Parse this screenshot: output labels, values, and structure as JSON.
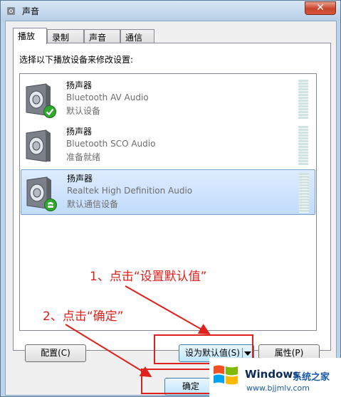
{
  "window": {
    "title": "声音",
    "close_glyph": "✕"
  },
  "tabs": [
    {
      "label": "播放",
      "active": true
    },
    {
      "label": "录制",
      "active": false
    },
    {
      "label": "声音",
      "active": false
    },
    {
      "label": "通信",
      "active": false
    }
  ],
  "instruction": "选择以下播放设备来修改设置:",
  "devices": [
    {
      "name": "扬声器",
      "description": "Bluetooth AV Audio",
      "status": "默认设备",
      "badge": "green-check",
      "selected": false
    },
    {
      "name": "扬声器",
      "description": "Bluetooth SCO Audio",
      "status": "准备就绪",
      "badge": "none",
      "selected": false
    },
    {
      "name": "扬声器",
      "description": "Realtek High Definition Audio",
      "status": "默认通信设备",
      "badge": "green-phone",
      "selected": true
    }
  ],
  "buttons": {
    "configure": "配置(C)",
    "set_default": "设为默认值(S)",
    "properties": "属性(P)",
    "ok": "确定"
  },
  "annotations": {
    "step1": "1、点击“设置默认值”",
    "step2": "2、点击“确定”"
  },
  "watermark": {
    "brand": "Windows",
    "brand_cn": "系统之家",
    "url": "www.bjjmlv.com"
  },
  "colors": {
    "annotation_red": "#e0201a",
    "selection_blue": "#c2dcfd",
    "status_gray": "#6d6d6d"
  }
}
